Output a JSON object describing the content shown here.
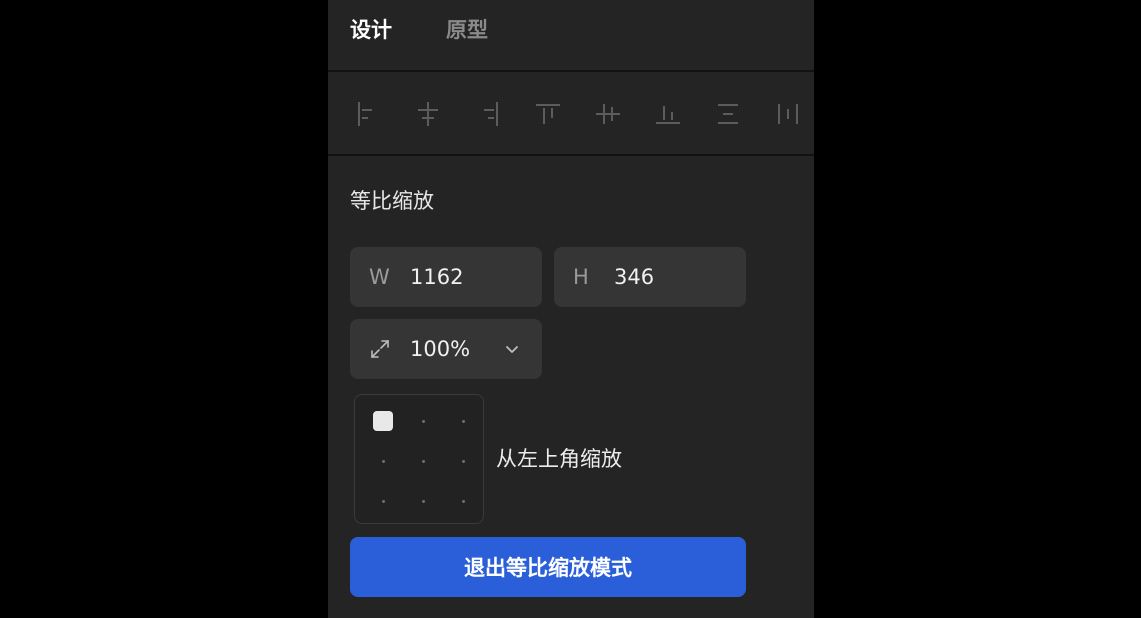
{
  "tabs": [
    {
      "label": "设计",
      "active": true
    },
    {
      "label": "原型",
      "active": false
    }
  ],
  "alignment_tools": [
    {
      "icon": "align-left-icon"
    },
    {
      "icon": "align-horizontal-center-icon"
    },
    {
      "icon": "align-right-icon"
    },
    {
      "icon": "align-top-icon"
    },
    {
      "icon": "align-vertical-center-icon"
    },
    {
      "icon": "align-bottom-icon"
    },
    {
      "icon": "distribute-vertical-icon"
    },
    {
      "icon": "distribute-horizontal-icon"
    }
  ],
  "scale": {
    "title": "等比缩放",
    "width": {
      "prefix": "W",
      "value": "1162"
    },
    "height": {
      "prefix": "H",
      "value": "346"
    },
    "zoom": {
      "value": "100%",
      "icon": "expand-arrows-icon"
    },
    "anchor": {
      "selected": "top-left",
      "label": "从左上角缩放"
    },
    "exit_label": "退出等比缩放模式"
  },
  "colors": {
    "panel": "#242424",
    "field": "#353535",
    "accent": "#2b5fd9",
    "background": "#000000"
  }
}
